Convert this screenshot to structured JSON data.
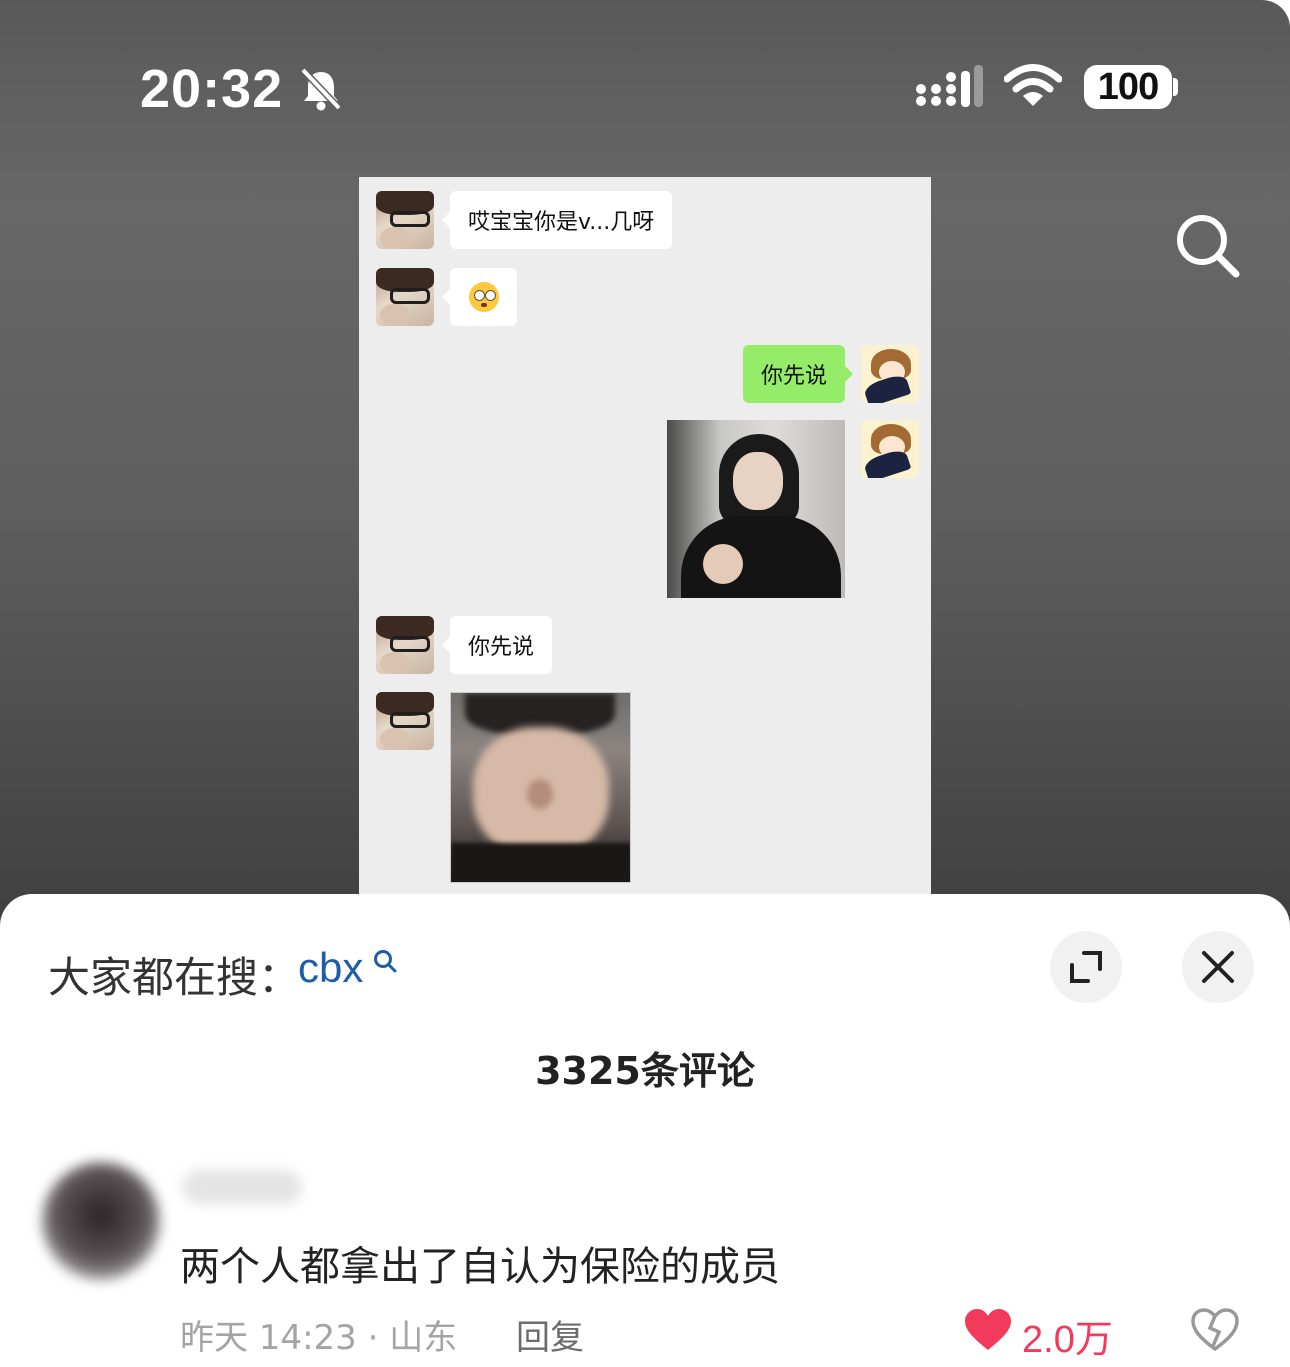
{
  "status_bar": {
    "time": "20:32",
    "battery": "100"
  },
  "video": {
    "chat_messages": [
      {
        "side": "left",
        "type": "text",
        "text": "哎宝宝你是v...几呀"
      },
      {
        "side": "left",
        "type": "emoji",
        "emoji": "flushed-face-emoji"
      },
      {
        "side": "right",
        "type": "text",
        "text": "你先说"
      },
      {
        "side": "right",
        "type": "image",
        "image": "photo-man-hoodie"
      },
      {
        "side": "left",
        "type": "text",
        "text": "你先说"
      },
      {
        "side": "left",
        "type": "image",
        "image": "photo-blurry-face"
      }
    ]
  },
  "comments_sheet": {
    "search_prefix": "大家都在搜：",
    "search_term": "cbx",
    "title": "3325条评论",
    "comments": [
      {
        "text": "两个人都拿出了自认为保险的成员",
        "meta": "昨天 14:23 · 山东",
        "reply_label": "回复",
        "likes": "2.0万"
      }
    ]
  },
  "colors": {
    "accent_link": "#1f5da8",
    "like_red": "#f23a5c",
    "bubble_green": "#95ec69"
  },
  "icons": [
    "bell-slash-icon",
    "signal-icon",
    "wifi-icon",
    "battery-icon",
    "search-icon",
    "expand-icon",
    "close-icon",
    "heart-icon",
    "dislike-icon"
  ]
}
